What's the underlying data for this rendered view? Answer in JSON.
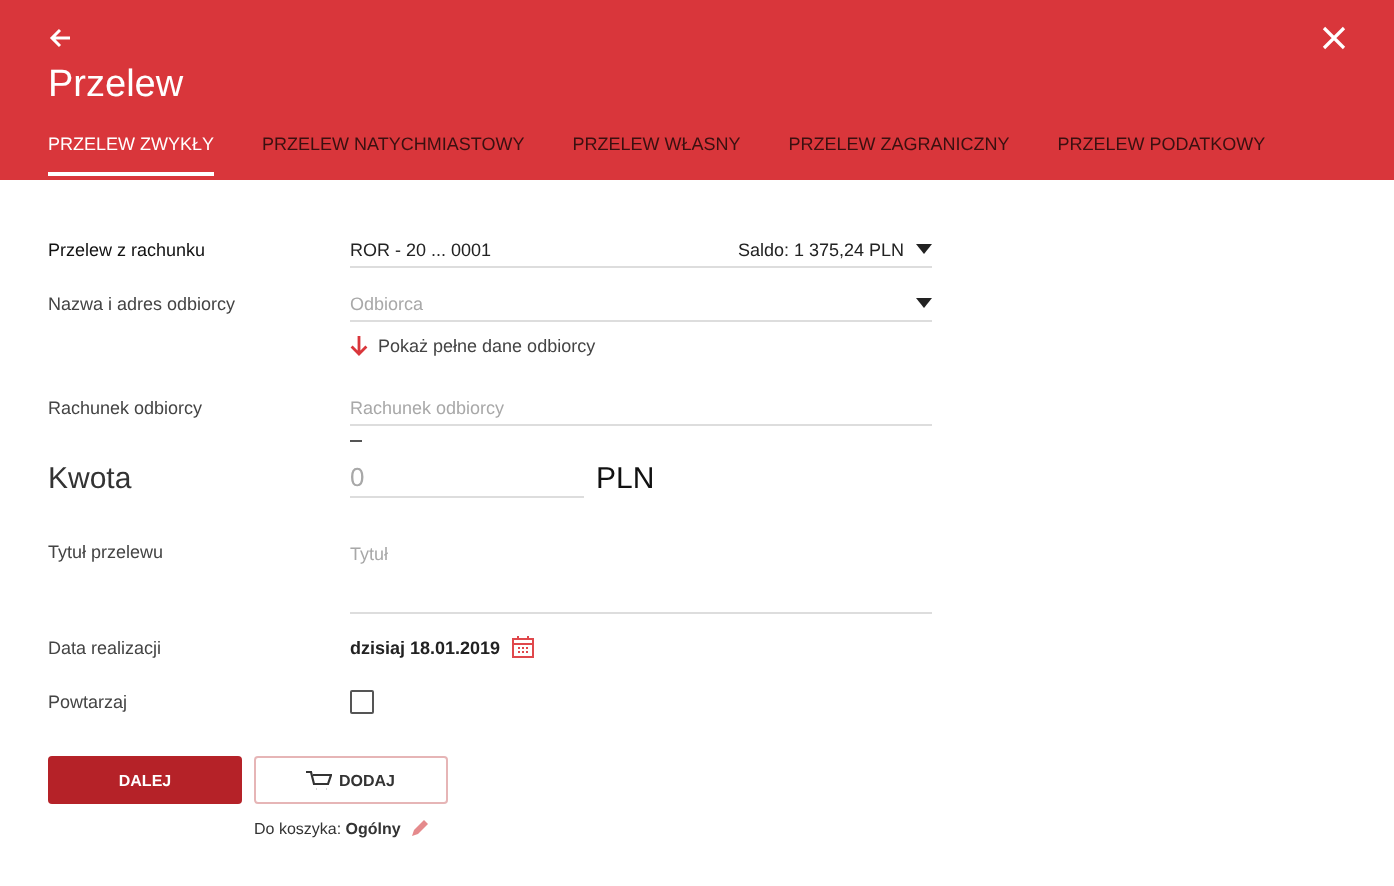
{
  "header": {
    "title": "Przelew"
  },
  "tabs": [
    {
      "label": "PRZELEW ZWYKŁY",
      "selected": true
    },
    {
      "label": "PRZELEW NATYCHMIASTOWY",
      "selected": false
    },
    {
      "label": "PRZELEW WŁASNY",
      "selected": false
    },
    {
      "label": "PRZELEW ZAGRANICZNY",
      "selected": false
    },
    {
      "label": "PRZELEW PODATKOWY",
      "selected": false
    }
  ],
  "form": {
    "account": {
      "label": "Przelew z rachunku",
      "value": "ROR - 20 ... 0001",
      "balance": "Saldo: 1 375,24 PLN"
    },
    "recipient": {
      "label": "Nazwa i adres odbiorcy",
      "placeholder": "Odbiorca",
      "link": "Pokaż pełne dane odbiorcy"
    },
    "recipient_account": {
      "label": "Rachunek odbiorcy",
      "placeholder": "Rachunek odbiorcy"
    },
    "amount": {
      "label": "Kwota",
      "placeholder": "0",
      "currency": "PLN"
    },
    "title": {
      "label": "Tytuł przelewu",
      "placeholder": "Tytuł"
    },
    "date": {
      "label": "Data realizacji",
      "value": "dzisiaj 18.01.2019"
    },
    "repeat": {
      "label": "Powtarzaj",
      "checked": false
    }
  },
  "buttons": {
    "next": "DALEJ",
    "add": "DODAJ"
  },
  "cart": {
    "label": "Do koszyka:",
    "name": "Ogólny"
  }
}
